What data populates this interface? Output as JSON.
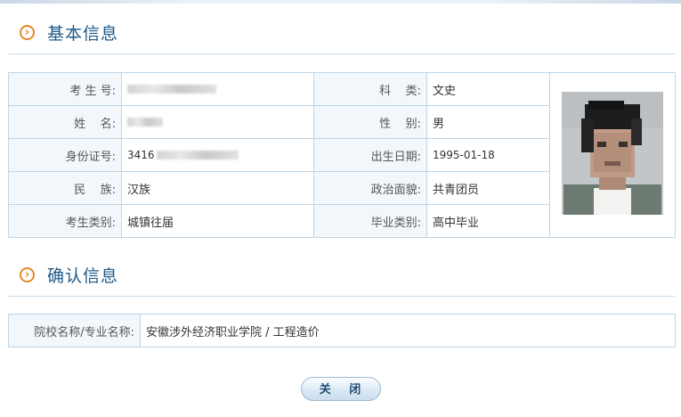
{
  "basic_section": {
    "title": "基本信息",
    "icon": "chevron-circle-icon"
  },
  "basic_rows": [
    {
      "l1": "考 生 号:",
      "v1": "",
      "l2": "科    类:",
      "v2": "文史"
    },
    {
      "l1": "姓    名:",
      "v1": "",
      "l2": "性    别:",
      "v2": "男"
    },
    {
      "l1": "身份证号:",
      "v1": "3416",
      "l2": "出生日期:",
      "v2": "1995-01-18"
    },
    {
      "l1": "民    族:",
      "v1": "汉族",
      "l2": "政治面貌:",
      "v2": "共青团员"
    },
    {
      "l1": "考生类别:",
      "v1": "城镇往届",
      "l2": "毕业类别:",
      "v2": "高中毕业"
    }
  ],
  "confirm_section": {
    "title": "确认信息",
    "icon": "chevron-circle-icon"
  },
  "confirm": {
    "label": "院校名称/专业名称:",
    "value": "安徽涉外经济职业学院 / 工程造价"
  },
  "close_button": "关 闭",
  "colors": {
    "accent": "#e8872a",
    "heading": "#1e5a8a",
    "border": "#bfd5e6",
    "label_bg": "#f2f7fb"
  }
}
